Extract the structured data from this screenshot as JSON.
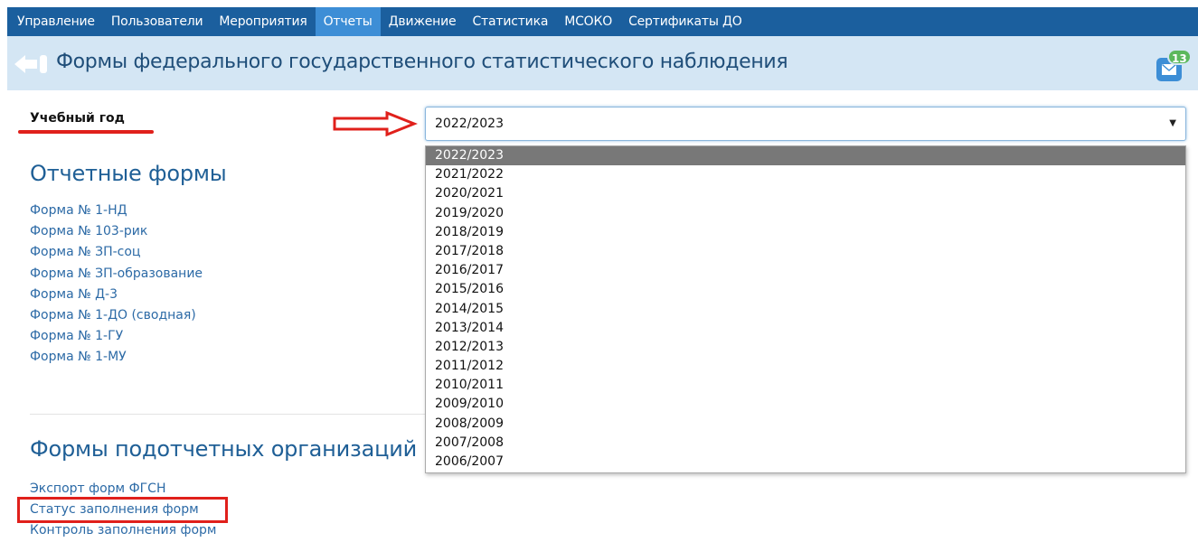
{
  "nav": {
    "items": [
      "Управление",
      "Пользователи",
      "Мероприятия",
      "Отчеты",
      "Движение",
      "Статистика",
      "МСОКО",
      "Сертификаты ДО"
    ],
    "active_index": 3,
    "colors": {
      "bar": "#1b5f9e",
      "active": "#3d8ed6"
    }
  },
  "header": {
    "title": "Формы федерального государственного статистического наблюдения",
    "back_icon": "back-arrow-icon",
    "mail_icon": "envelope-icon",
    "mail_count": "13"
  },
  "year_filter": {
    "label": "Учебный год",
    "selected": "2022/2023",
    "options": [
      "2022/2023",
      "2021/2022",
      "2020/2021",
      "2019/2020",
      "2018/2019",
      "2017/2018",
      "2016/2017",
      "2015/2016",
      "2014/2015",
      "2013/2014",
      "2012/2013",
      "2011/2012",
      "2010/2011",
      "2009/2010",
      "2008/2009",
      "2007/2008",
      "2006/2007"
    ],
    "caret": "▼"
  },
  "report_forms": {
    "title": "Отчетные формы",
    "links": [
      "Форма № 1-НД",
      "Форма № 103-рик",
      "Форма № ЗП-соц",
      "Форма № ЗП-образование",
      "Форма № Д-3",
      "Форма № 1-ДО (сводная)",
      "Форма № 1-ГУ",
      "Форма № 1-МУ"
    ]
  },
  "sub_org_forms": {
    "title": "Формы подотчетных организаций",
    "links": [
      "Экспорт форм ФГСН",
      "Статус заполнения форм",
      "Контроль заполнения форм"
    ]
  },
  "annotations": {
    "color": "#e0201b"
  }
}
